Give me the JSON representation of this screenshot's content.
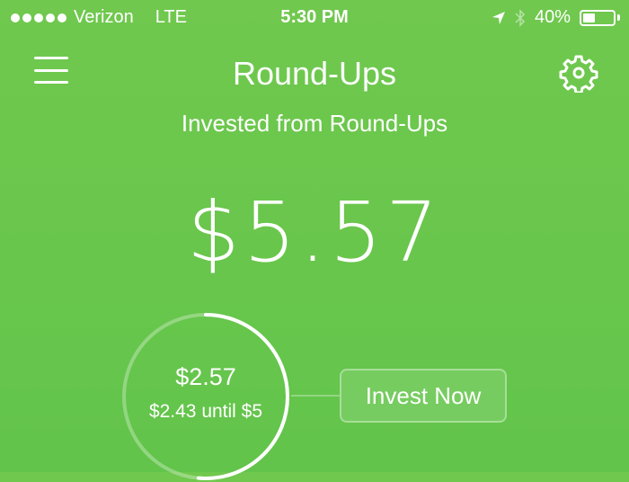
{
  "status_bar": {
    "signal_dots": 5,
    "carrier": "Verizon",
    "network": "LTE",
    "time": "5:30 PM",
    "battery_percent_label": "40%",
    "battery_level": 0.4
  },
  "nav": {
    "title": "Round-Ups",
    "menu_icon": "hamburger-menu-icon",
    "settings_icon": "gear-icon"
  },
  "summary": {
    "subtitle": "Invested from Round-Ups",
    "total": "$5.57"
  },
  "progress": {
    "amount": "$2.57",
    "remaining_label": "$2.43 until $5",
    "fraction": 0.514
  },
  "actions": {
    "invest_now_label": "Invest Now"
  },
  "colors": {
    "background": "#6cc74d",
    "foreground": "#ffffff"
  }
}
